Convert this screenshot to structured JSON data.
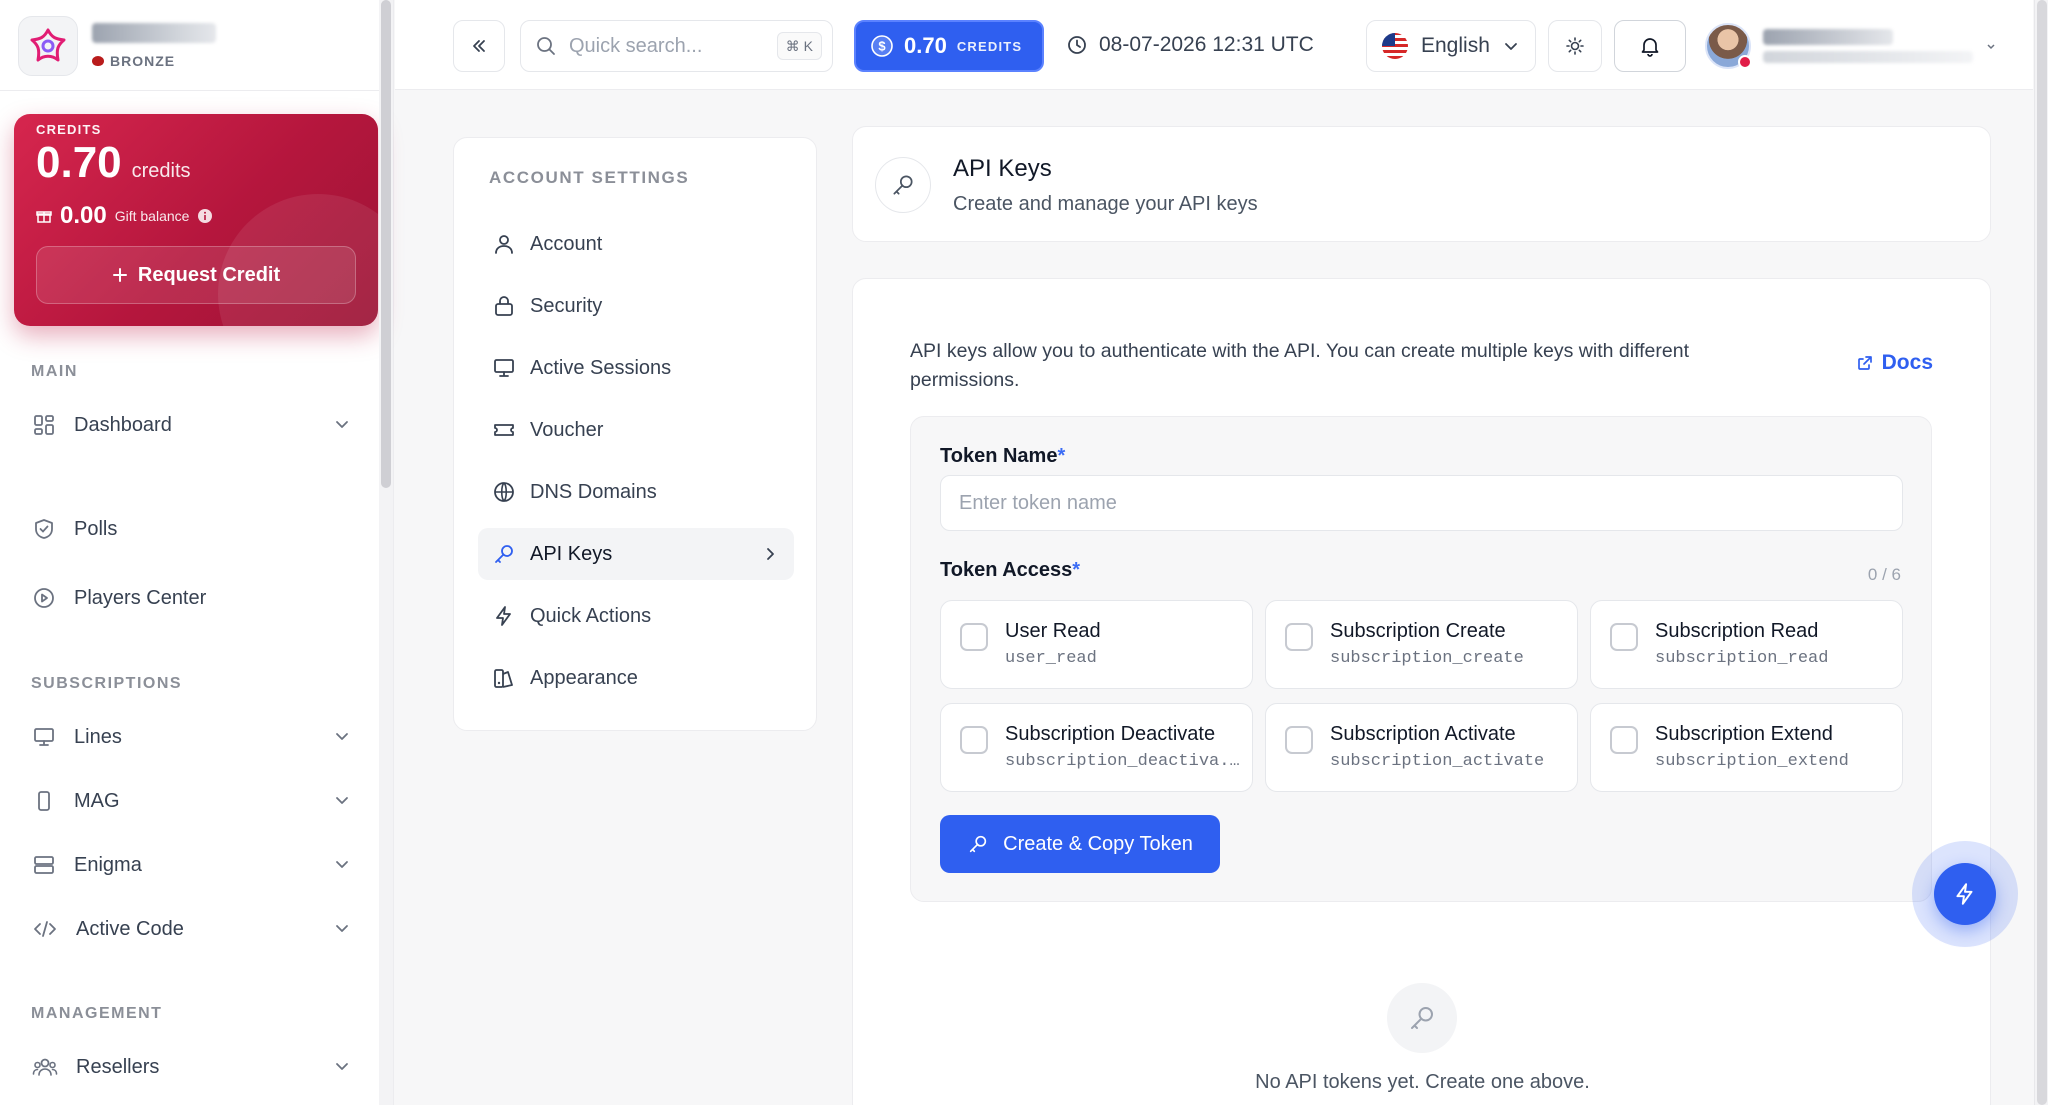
{
  "brand": {
    "tier": "BRONZE"
  },
  "credit_card": {
    "label": "CREDITS",
    "amount": "0.70",
    "unit": "credits",
    "gift_amount": "0.00",
    "gift_label": "Gift balance",
    "button": "Request Credit"
  },
  "sidebar": {
    "sections": {
      "main": "MAIN",
      "subscriptions": "SUBSCRIPTIONS",
      "management": "MANAGEMENT"
    },
    "items": [
      {
        "label": "Dashboard"
      },
      {
        "label": "Polls"
      },
      {
        "label": "Players Center"
      },
      {
        "label": "Lines"
      },
      {
        "label": "MAG"
      },
      {
        "label": "Enigma"
      },
      {
        "label": "Active Code"
      },
      {
        "label": "Resellers"
      }
    ]
  },
  "topbar": {
    "search_placeholder": "Quick search...",
    "shortcut": "⌘ K",
    "credits_value": "0.70",
    "credits_label": "CREDITS",
    "datetime": "08-07-2026 12:31 UTC",
    "language": "English"
  },
  "settings_nav": {
    "title": "ACCOUNT SETTINGS",
    "items": [
      {
        "label": "Account",
        "icon": "user-icon"
      },
      {
        "label": "Security",
        "icon": "lock-icon"
      },
      {
        "label": "Active Sessions",
        "icon": "monitor-icon"
      },
      {
        "label": "Voucher",
        "icon": "ticket-icon"
      },
      {
        "label": "DNS Domains",
        "icon": "globe-icon"
      },
      {
        "label": "API Keys",
        "icon": "key-icon",
        "active": true
      },
      {
        "label": "Quick Actions",
        "icon": "bolt-icon"
      },
      {
        "label": "Appearance",
        "icon": "palette-icon"
      }
    ]
  },
  "page": {
    "title": "API Keys",
    "subtitle": "Create and manage your API keys",
    "intro": "API keys allow you to authenticate with the API. You can create multiple keys with different permissions.",
    "docs_label": "Docs"
  },
  "form": {
    "token_name_label": "Token Name",
    "required_mark": "*",
    "token_name_placeholder": "Enter token name",
    "token_access_label": "Token Access",
    "selected_count": "0 / 6",
    "permissions": [
      {
        "title": "User Read",
        "code": "user_read",
        "checked": false
      },
      {
        "title": "Subscription Create",
        "code": "subscription_create",
        "checked": false
      },
      {
        "title": "Subscription Read",
        "code": "subscription_read",
        "checked": false
      },
      {
        "title": "Subscription Deactivate",
        "code": "subscription_deactiva...",
        "checked": false
      },
      {
        "title": "Subscription Activate",
        "code": "subscription_activate",
        "checked": false
      },
      {
        "title": "Subscription Extend",
        "code": "subscription_extend",
        "checked": false
      }
    ],
    "create_button": "Create & Copy Token"
  },
  "empty_state": {
    "text": "No API tokens yet. Create one above."
  },
  "colors": {
    "accent": "#2f5ff0",
    "credit_card": "#c81e48",
    "text": "#1f2937"
  }
}
